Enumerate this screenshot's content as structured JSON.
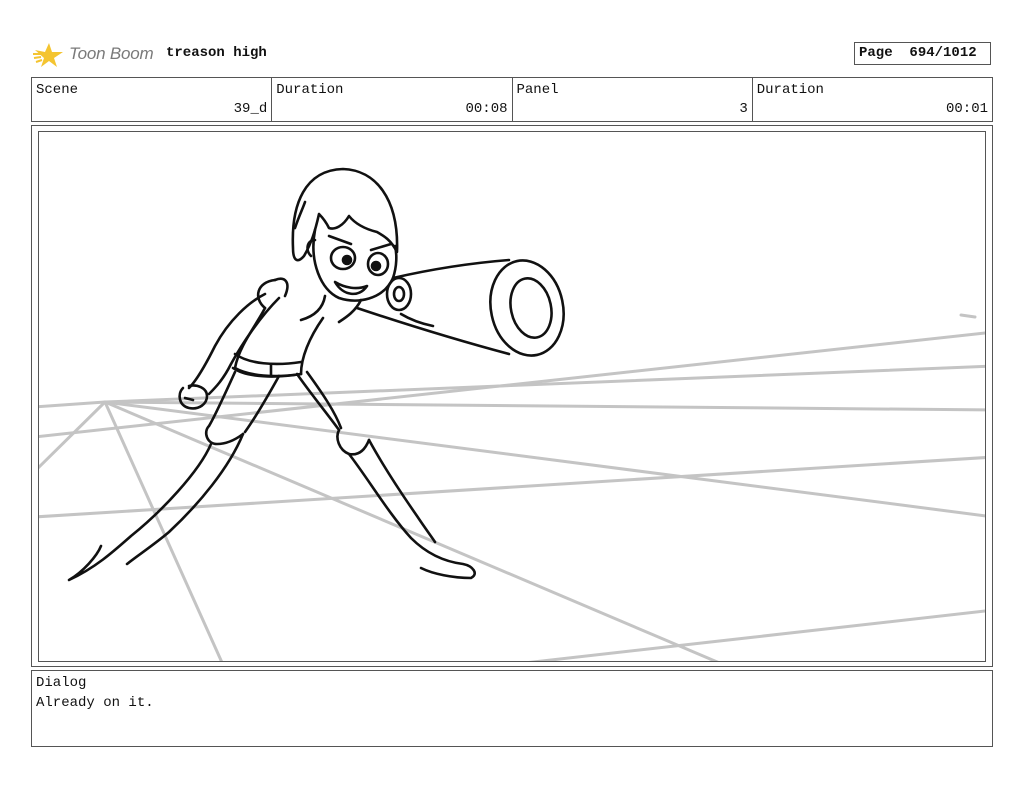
{
  "header": {
    "logo_text": "Toon Boom",
    "project_title": "treason high",
    "page_label": "Page",
    "page_value": "694/1012"
  },
  "info": {
    "scene_label": "Scene",
    "scene_value": "39_d",
    "scene_duration_label": "Duration",
    "scene_duration_value": "00:08",
    "panel_label": "Panel",
    "panel_value": "3",
    "panel_duration_label": "Duration",
    "panel_duration_value": "00:01"
  },
  "dialog": {
    "label": "Dialog",
    "text": "Already on it."
  },
  "colors": {
    "logo_star": "#f4c430",
    "logo_text": "#7a7a7a",
    "perspective_lines": "#c4c4c4",
    "border": "#555555"
  }
}
